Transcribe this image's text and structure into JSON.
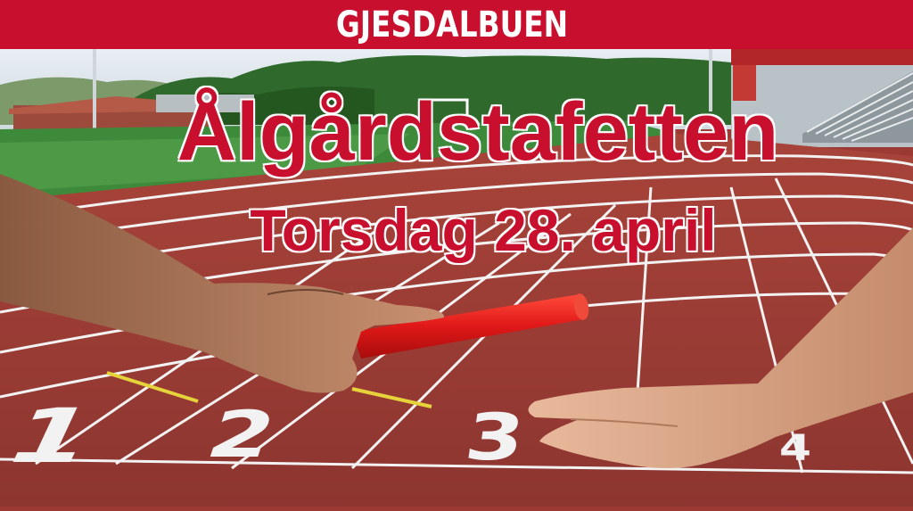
{
  "header": {
    "brand": "GJESDALBUEN"
  },
  "poster": {
    "title": "Ålgårdstafetten",
    "subtitle": "Torsdag 28. april",
    "lane_numbers": [
      "1",
      "2",
      "3",
      "4"
    ]
  },
  "colors": {
    "brand_red": "#c8102e",
    "track": "#9a3a33",
    "grass": "#3d8a3b",
    "sky": "#dfe8ef",
    "baton": "#e02020"
  },
  "icons": [
    "relay-baton-icon",
    "hand-icon"
  ]
}
